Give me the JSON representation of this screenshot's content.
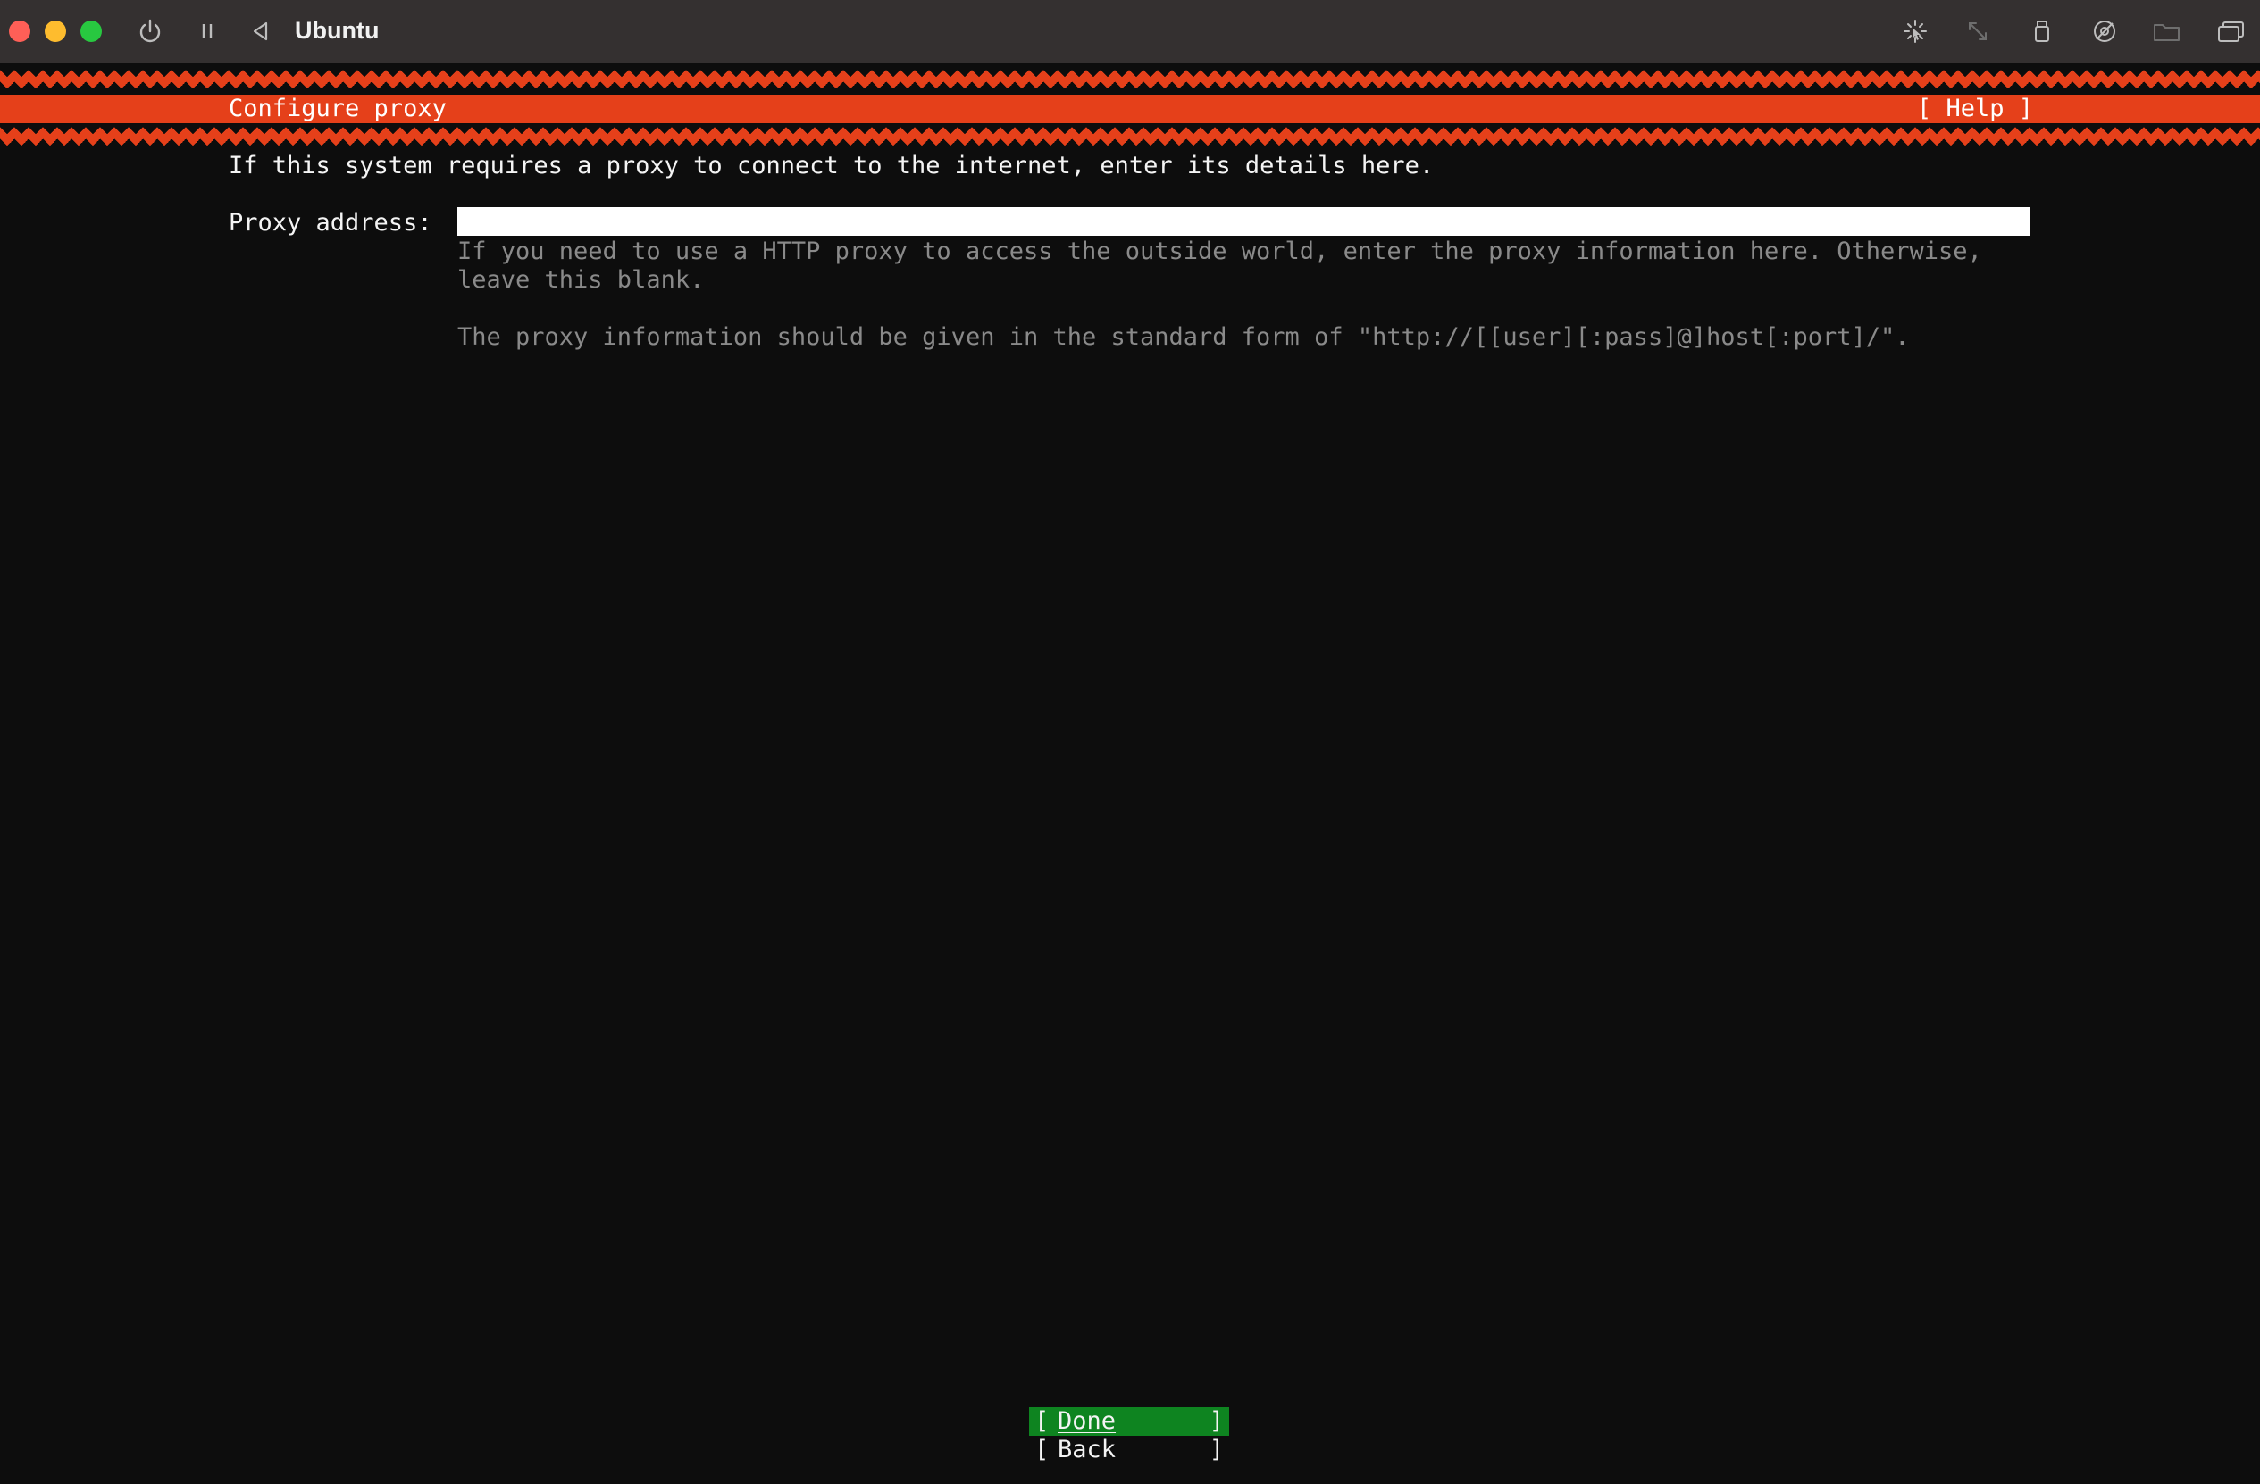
{
  "window": {
    "title": "Ubuntu"
  },
  "toolbar": {
    "icons": [
      "power-icon",
      "pause-icon",
      "back-icon",
      "cursor-capture-icon",
      "resize-icon",
      "usb-icon",
      "audio-icon",
      "shared-folder-icon",
      "display-icon"
    ]
  },
  "installer": {
    "header_title": "Configure proxy",
    "help_label": "[ Help ]",
    "intro": "If this system requires a proxy to connect to the internet, enter its details here.",
    "proxy_label": "Proxy address:",
    "proxy_value": "",
    "help_line1": "If you need to use a HTTP proxy to access the outside world, enter the proxy information here. Otherwise,",
    "help_line2": "leave this blank.",
    "help_line3": "The proxy information should be given in the standard form of \"http://[[user][:pass]@]host[:port]/\".",
    "buttons": {
      "done": "Done",
      "back": "Back"
    }
  },
  "colors": {
    "accent": "#e5401a",
    "done_button": "#0e8420",
    "background": "#0d0d0d",
    "titlebar": "#343030"
  }
}
